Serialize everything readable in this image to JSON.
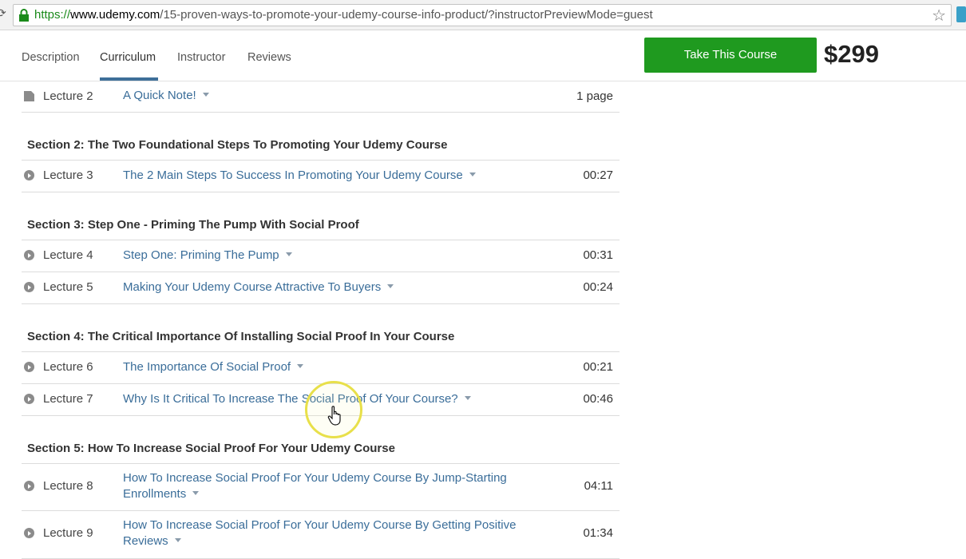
{
  "browser": {
    "url_scheme": "https://",
    "url_host": "www.udemy.com",
    "url_path": "/15-proven-ways-to-promote-your-udemy-course-info-product/?instructorPreviewMode=guest"
  },
  "nav": {
    "tabs": [
      "Description",
      "Curriculum",
      "Instructor",
      "Reviews"
    ],
    "active_tab": "Curriculum",
    "cta_label": "Take This Course",
    "price": "$299"
  },
  "curriculum": {
    "rows": [
      {
        "kind": "lecture",
        "lecture": "Lecture 2",
        "title": "A Quick Note!",
        "duration": "1 page",
        "icon": "document-icon"
      },
      {
        "kind": "section",
        "title": "Section 2: The Two Foundational Steps To Promoting Your Udemy Course"
      },
      {
        "kind": "lecture",
        "lecture": "Lecture 3",
        "title": "The 2 Main Steps To Success In Promoting Your Udemy Course",
        "duration": "00:27",
        "icon": "play-icon"
      },
      {
        "kind": "section",
        "title": "Section 3: Step One - Priming The Pump With Social Proof"
      },
      {
        "kind": "lecture",
        "lecture": "Lecture 4",
        "title": "Step One: Priming The Pump",
        "duration": "00:31",
        "icon": "play-icon"
      },
      {
        "kind": "lecture",
        "lecture": "Lecture 5",
        "title": "Making Your Udemy Course Attractive To Buyers",
        "duration": "00:24",
        "icon": "play-icon"
      },
      {
        "kind": "section",
        "title": "Section 4: The Critical Importance Of Installing Social Proof In Your Course"
      },
      {
        "kind": "lecture",
        "lecture": "Lecture 6",
        "title": "The Importance Of Social Proof",
        "duration": "00:21",
        "icon": "play-icon"
      },
      {
        "kind": "lecture",
        "lecture": "Lecture 7",
        "title": "Why Is It Critical To Increase The Social Proof Of Your Course?",
        "duration": "00:46",
        "icon": "play-icon"
      },
      {
        "kind": "section",
        "title": "Section 5: How To Increase Social Proof For Your Udemy Course"
      },
      {
        "kind": "lecture",
        "lecture": "Lecture 8",
        "title": "How To Increase Social Proof For Your Udemy Course By Jump-Starting Enrollments",
        "duration": "04:11",
        "icon": "play-icon"
      },
      {
        "kind": "lecture",
        "lecture": "Lecture 9",
        "title": "How To Increase Social Proof For Your Udemy Course By Getting Positive Reviews",
        "duration": "01:34",
        "icon": "play-icon"
      }
    ]
  },
  "colors": {
    "cta_green": "#1f9a1f",
    "link_blue": "#3a6d99",
    "tab_underline": "#3e6f99",
    "https_green": "#1a8a1a"
  }
}
